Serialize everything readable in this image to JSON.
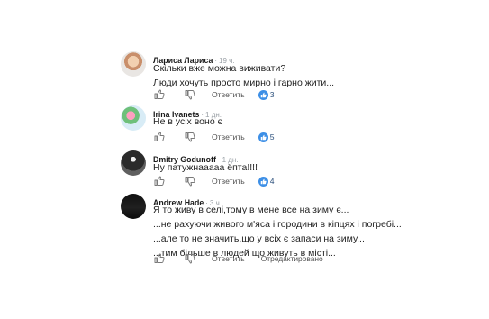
{
  "comments": [
    {
      "author": "Лариса Лариса",
      "time": "19 ч.",
      "lines": [
        "Скільки вже можна виживати?",
        "Люди хочуть просто мирно і гарно жити..."
      ],
      "reply_label": "Ответить",
      "reaction_count": "3"
    },
    {
      "author": "Irina Ivanets",
      "time": "1 дн.",
      "lines": [
        "Не в усіх воно є"
      ],
      "reply_label": "Ответить",
      "reaction_count": "5"
    },
    {
      "author": "Dmitry Godunoff",
      "time": "1 дн.",
      "lines": [
        "Ну патужнааааа ёпта!!!!"
      ],
      "reply_label": "Ответить",
      "reaction_count": "4"
    },
    {
      "author": "Andrew Hade",
      "time": "3 ч.",
      "lines": [
        "Я то живу в селі,тому в мене все на зиму є...",
        "...не рахуючи живого м'яса і городини в кіпцях і погребі...",
        "...але то не значить,що у всіх є запаси на зиму...",
        "...тим більше в людей що живуть в місті..."
      ],
      "reply_label": "Ответить",
      "edited_label": "Отредактировано"
    }
  ],
  "colors": {
    "accent": "#3d8fe6",
    "icon_gray": "#7a7a7a"
  }
}
